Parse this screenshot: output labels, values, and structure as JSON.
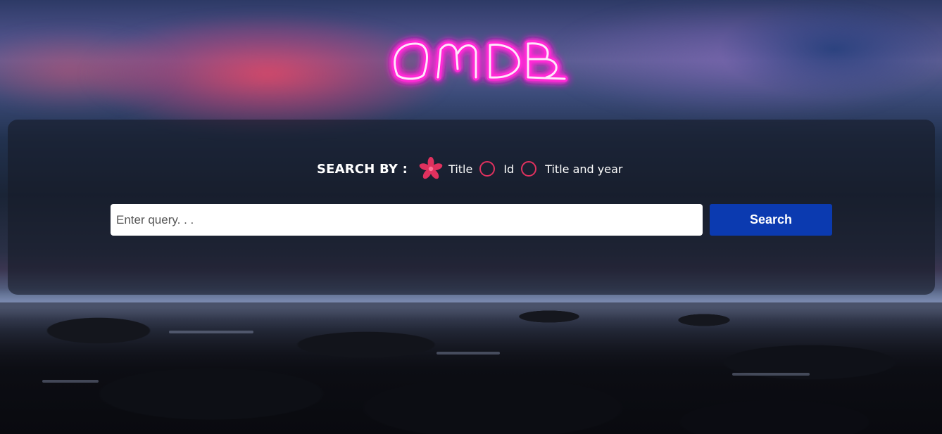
{
  "app": {
    "logo_text": "OMDB"
  },
  "search": {
    "label": "SEARCH BY :",
    "options": [
      {
        "label": "Title",
        "selected": true
      },
      {
        "label": "Id",
        "selected": false
      },
      {
        "label": "Title and year",
        "selected": false
      }
    ],
    "query_value": "",
    "query_placeholder": "Enter query. . .",
    "button_label": "Search"
  },
  "colors": {
    "accent": "#e0315e",
    "button": "#0b3ab0",
    "logo_glow": "#ff2bd6"
  },
  "icons": {
    "selected_radio": "flower-icon",
    "unselected_radio": "circle-icon"
  }
}
